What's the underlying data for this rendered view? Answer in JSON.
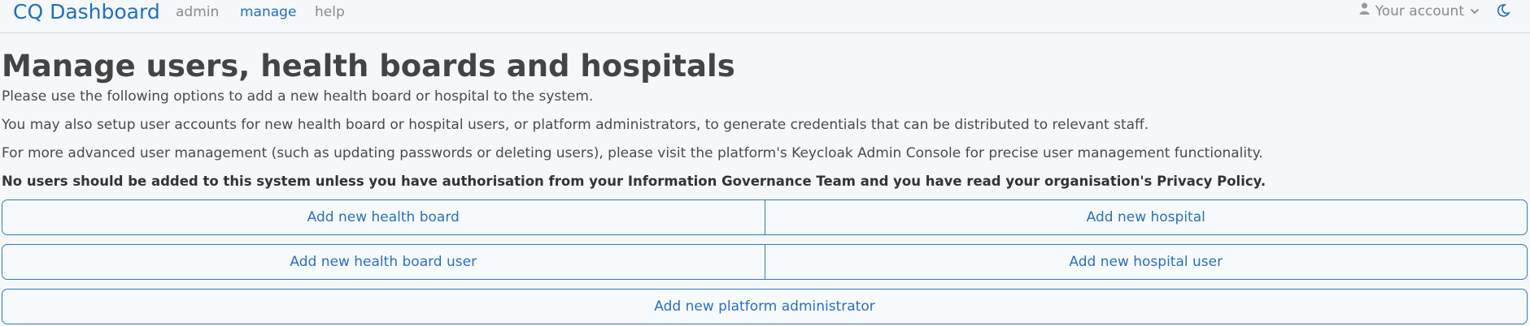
{
  "nav": {
    "brand": "CQ Dashboard",
    "links": [
      "admin",
      "manage",
      "help"
    ],
    "active": "manage",
    "account_label": "Your account"
  },
  "page": {
    "title": "Manage users, health boards and hospitals",
    "paragraphs": [
      "Please use the following options to add a new health board or hospital to the system.",
      "You may also setup user accounts for new health board or hospital users, or platform administrators, to generate credentials that can be distributed to relevant staff.",
      "For more advanced user management (such as updating passwords or deleting users), please visit the platform's Keycloak Admin Console for precise user management functionality."
    ],
    "warning": "No users should be added to this system unless you have authorisation from your Information Governance Team and you have read your organisation's Privacy Policy."
  },
  "buttons": {
    "add_health_board": "Add new health board",
    "add_hospital": "Add new hospital",
    "add_health_board_user": "Add new health board user",
    "add_hospital_user": "Add new hospital user",
    "add_platform_admin": "Add new platform administrator"
  },
  "colors": {
    "accent": "#1f6fbf",
    "border": "#2f79c8",
    "muted": "#8a8a8a"
  },
  "icons": {
    "account": "user-icon",
    "dropdown": "chevron-down-icon",
    "theme": "moon-icon"
  }
}
